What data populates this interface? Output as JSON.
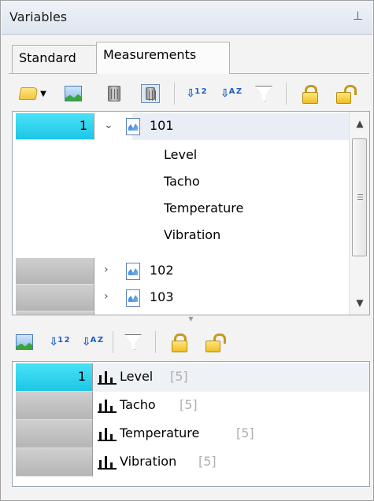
{
  "panel": {
    "title": "Variables",
    "pin_icon": "pin-icon"
  },
  "tabs": [
    {
      "label": "Standard",
      "active": false
    },
    {
      "label": "Measurements",
      "active": true
    }
  ],
  "toolbar_top": [
    "open-folder-icon",
    "chart-icon",
    "delete-icon",
    "delete-all-icon",
    "sort-numeric-icon",
    "sort-alpha-icon",
    "filter-icon",
    "lock-icon",
    "unlock-icon"
  ],
  "tree": {
    "rows": [
      {
        "num": "1",
        "label": "101",
        "expanded": true,
        "arrow": "⌄",
        "children": [
          "Level",
          "Tacho",
          "Temperature",
          "Vibration"
        ]
      },
      {
        "num": "",
        "label": "102",
        "expanded": false,
        "arrow": "›"
      },
      {
        "num": "",
        "label": "103",
        "expanded": false,
        "arrow": "›"
      }
    ]
  },
  "toolbar_bottom": [
    "chart-icon",
    "sort-numeric-icon",
    "sort-alpha-icon",
    "filter-icon",
    "lock-icon",
    "unlock-icon"
  ],
  "list": {
    "rows": [
      {
        "num": "1",
        "name": "Level",
        "count": "[5]"
      },
      {
        "num": "",
        "name": "Tacho",
        "count": "[5]"
      },
      {
        "num": "",
        "name": "Temperature",
        "count": "[5]"
      },
      {
        "num": "",
        "name": "Vibration",
        "count": "[5]"
      }
    ]
  },
  "colors": {
    "accent_cyan": "#1ec6e6",
    "selection": "#e9eef6"
  }
}
